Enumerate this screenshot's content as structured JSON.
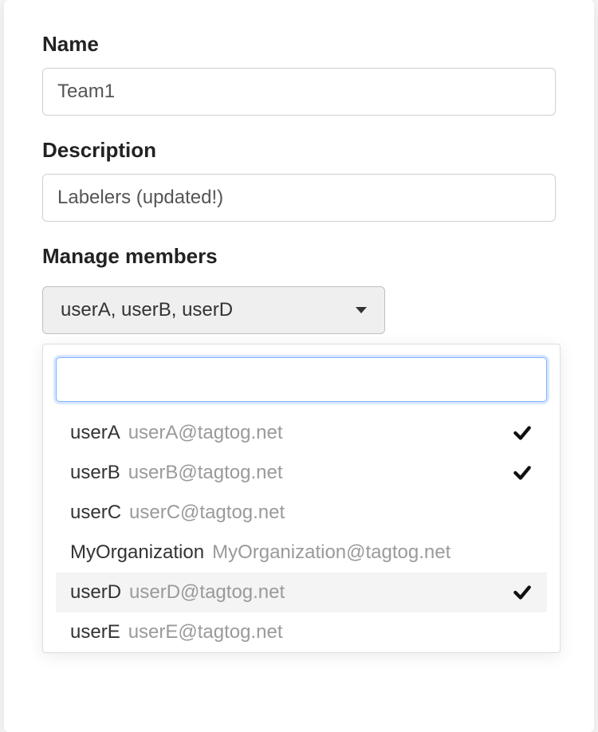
{
  "form": {
    "name_label": "Name",
    "name_value": "Team1",
    "description_label": "Description",
    "description_value": "Labelers (updated!)",
    "members_label": "Manage members"
  },
  "dropdown": {
    "summary": "userA, userB, userD",
    "search_value": "",
    "options": [
      {
        "name": "userA",
        "email": "userA@tagtog.net",
        "selected": true,
        "hovered": false
      },
      {
        "name": "userB",
        "email": "userB@tagtog.net",
        "selected": true,
        "hovered": false
      },
      {
        "name": "userC",
        "email": "userC@tagtog.net",
        "selected": false,
        "hovered": false
      },
      {
        "name": "MyOrganization",
        "email": "MyOrganization@tagtog.net",
        "selected": false,
        "hovered": false
      },
      {
        "name": "userD",
        "email": "userD@tagtog.net",
        "selected": true,
        "hovered": true
      },
      {
        "name": "userE",
        "email": "userE@tagtog.net",
        "selected": false,
        "hovered": false
      }
    ]
  }
}
